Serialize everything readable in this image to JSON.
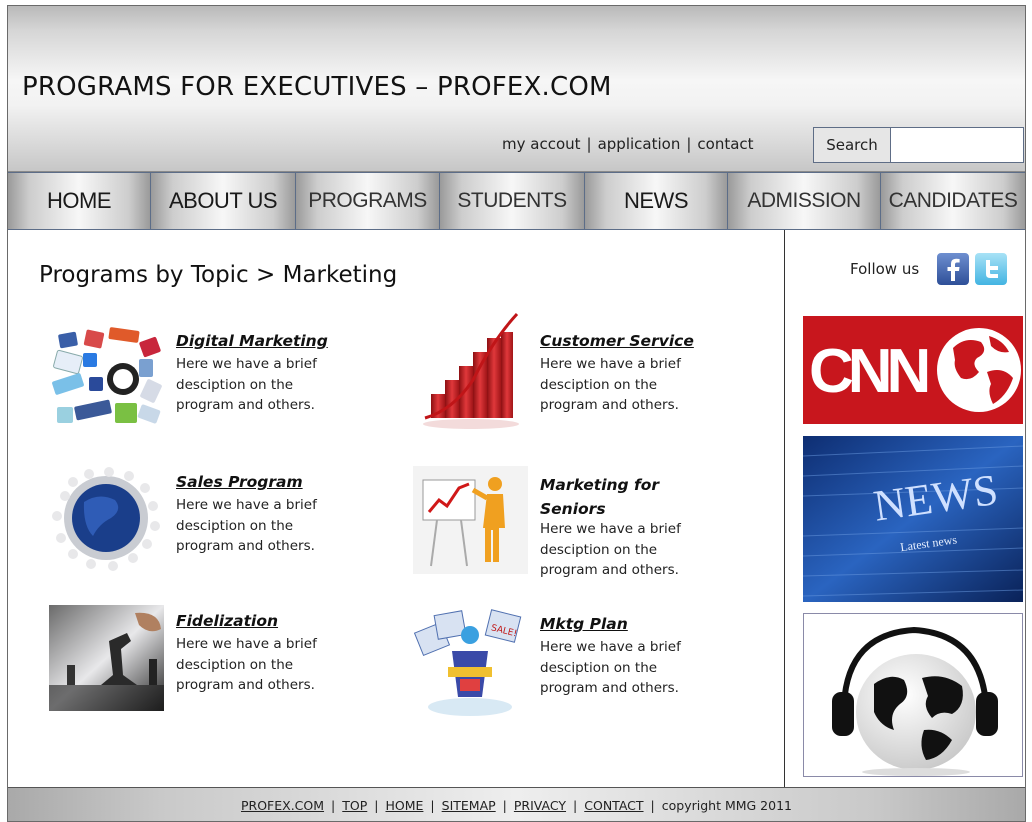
{
  "header": {
    "title": "PROGRAMS FOR EXECUTIVES – PROFEX.COM",
    "links": [
      "my accout",
      "application",
      "contact"
    ],
    "search_label": "Search",
    "search_value": ""
  },
  "nav": {
    "items": [
      "HOME",
      "ABOUT US",
      "PROGRAMS",
      "STUDENTS",
      "NEWS",
      "ADMISSION",
      "CANDIDATES"
    ]
  },
  "main": {
    "breadcrumb": "Programs by Topic > Marketing",
    "programs": [
      {
        "title": "Digital Marketing",
        "desc": "Here we have a brief desciption on the program and others.",
        "icon": "social-media-icons"
      },
      {
        "title": "Customer Service",
        "desc": "Here we have a brief desciption on the program and others.",
        "icon": "growth-bars-icon"
      },
      {
        "title": "Sales Program",
        "desc": "Here we have a brief desciption on the program and others.",
        "icon": "globe-people-icon"
      },
      {
        "title": "Marketing for Seniors",
        "desc": "Here we have a brief desciption on the program and others.",
        "icon": "presenter-chart-icon"
      },
      {
        "title": "Fidelization",
        "desc": "Here we have a brief desciption on the program and others.",
        "icon": "chess-icon"
      },
      {
        "title": "Mktg Plan",
        "desc": "Here we have a brief desciption on the program and others.",
        "icon": "sale-signs-icon"
      }
    ]
  },
  "sidebar": {
    "follow_text": "Follow us",
    "social": [
      "facebook-icon",
      "twitter-icon"
    ],
    "ads": [
      {
        "name": "cnn-ad",
        "text": "CNN"
      },
      {
        "name": "news-ad",
        "text": "NEWS",
        "subtext": "Latest news"
      },
      {
        "name": "headphones-globe-ad"
      }
    ]
  },
  "footer": {
    "links": [
      "PROFEX.COM",
      "TOP",
      "HOME",
      "SITEMAP",
      "PRIVACY",
      "CONTACT"
    ],
    "copyright": "copyright MMG 2011"
  },
  "colors": {
    "nav_border": "#5c6d88",
    "cnn_red": "#c8161d",
    "news_blue": "#1d4fa0",
    "facebook_blue": "#3b5998",
    "twitter_blue": "#5bc0e6"
  }
}
